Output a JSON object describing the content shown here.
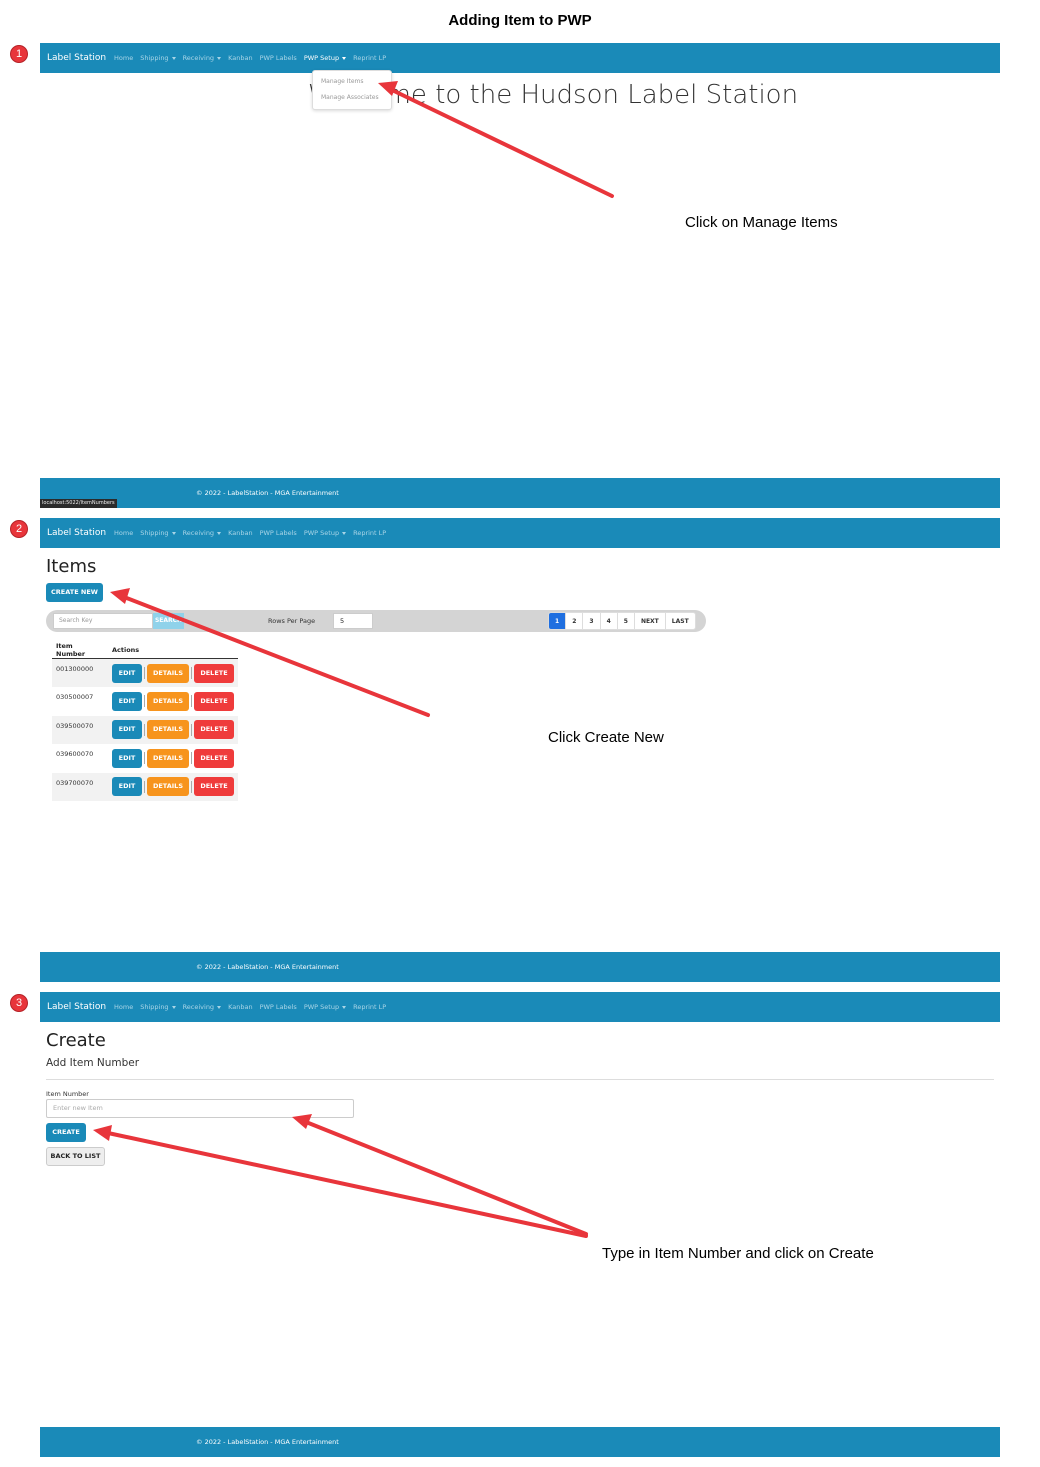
{
  "doc_title": "Adding Item to PWP",
  "steps": [
    "1",
    "2",
    "3"
  ],
  "nav": {
    "brand": "Label Station",
    "items": [
      "Home",
      "Shipping",
      "Receiving",
      "Kanban",
      "PWP Labels",
      "PWP Setup",
      "Reprint LP"
    ]
  },
  "footer_text": "© 2022 - LabelStation - MGA Entertainment",
  "step1": {
    "dropdown": [
      "Manage Items",
      "Manage Associates"
    ],
    "welcome": "Welcome to the Hudson Label Station",
    "status_url": "localhost:5022/ItemNumbers",
    "annotation": "Click on Manage Items"
  },
  "step2": {
    "title": "Items",
    "create_new": "CREATE NEW",
    "search_placeholder": "Search Key",
    "search_button": "SEARCH",
    "rows_per_page_label": "Rows Per Page",
    "rows_per_page_value": "5",
    "pager": [
      "1",
      "2",
      "3",
      "4",
      "5",
      "NEXT",
      "LAST"
    ],
    "table_headers": [
      "Item Number",
      "Actions"
    ],
    "rows": [
      "001300000",
      "030500007",
      "039500070",
      "039600070",
      "039700070"
    ],
    "actions": {
      "edit": "EDIT",
      "details": "DETAILS",
      "delete": "DELETE"
    },
    "annotation": "Click Create New"
  },
  "step3": {
    "title": "Create",
    "subtitle": "Add Item Number",
    "field_label": "Item Number",
    "field_placeholder": "Enter new Item",
    "create_button": "CREATE",
    "back_button": "BACK TO LIST",
    "annotation": "Type in Item Number and click on Create"
  },
  "colors": {
    "navbar": "#1a8ab8",
    "annotation_arrow": "#e8353b",
    "badge": "#e8353b"
  }
}
